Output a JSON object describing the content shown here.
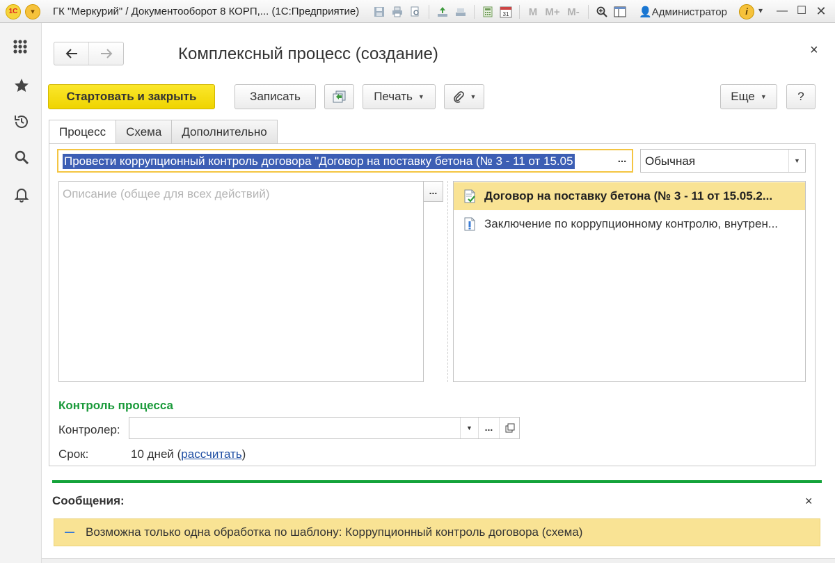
{
  "titlebar": {
    "title": "ГК \"Меркурий\" / Документооборот 8 КОРП,...  (1С:Предприятие)",
    "calendar_day": "31",
    "m_buttons": [
      "M",
      "M+",
      "M-"
    ],
    "user": "Администратор",
    "info": "i"
  },
  "form": {
    "title": "Комплексный процесс (создание)",
    "close": "×"
  },
  "toolbar": {
    "start_close": "Стартовать и закрыть",
    "save": "Записать",
    "print": "Печать",
    "more": "Еще",
    "help": "?"
  },
  "tabs": [
    "Процесс",
    "Схема",
    "Дополнительно"
  ],
  "process": {
    "subject": "Провести коррупционный контроль договора \"Договор на поставку бетона (№ 3 - 11 от 15.05",
    "ellipsis": "...",
    "priority": "Обычная",
    "description_placeholder": "Описание (общее для всех действий)",
    "attachments": [
      {
        "label": "Договор на поставку бетона (№ 3 - 11 от 15.05.2...",
        "icon": "document-check-icon"
      },
      {
        "label": "Заключение по коррупционному контролю, внутрен...",
        "icon": "document-warning-icon"
      }
    ]
  },
  "control": {
    "section_title": "Контроль процесса",
    "controller_label": "Контролер:",
    "controller_value": "",
    "term_label": "Срок:",
    "term_value": "10 дней (",
    "term_link": "рассчитать",
    "term_suffix": ")"
  },
  "messages": {
    "title": "Сообщения:",
    "close": "×",
    "items": [
      "Возможна только одна обработка по шаблону: Коррупционный контроль договора (схема)"
    ]
  },
  "colors": {
    "primary_button": "#f5df00",
    "selection": "#3c5eb4",
    "highlight_row": "#f9e394",
    "section_title": "#1a9a3a",
    "link": "#1f4ea3",
    "accent_bar": "#14a33a"
  }
}
